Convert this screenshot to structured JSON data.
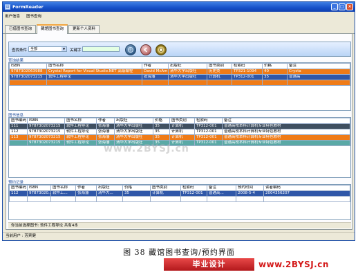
{
  "window": {
    "title": "FormReader",
    "app_icon": "app-form-icon",
    "buttons": [
      "_",
      "□",
      "×"
    ]
  },
  "menu": {
    "items": [
      "用户信息",
      "图书查询"
    ]
  },
  "tabs": [
    {
      "label": "已借图书查询"
    },
    {
      "label": "藏馆图书查询",
      "active": true
    },
    {
      "label": "更新个人资料"
    }
  ],
  "search": {
    "section_label": "查找条件",
    "condition_value": "全部",
    "keyword_label": "关键字",
    "keyword_value": "",
    "buttons": [
      {
        "name": "search-button",
        "icon": "globe-search-icon"
      },
      {
        "name": "back-button",
        "icon": "back-arrow-icon"
      },
      {
        "name": "reset-button",
        "icon": "ring-icon"
      }
    ]
  },
  "results": {
    "title": "查询结果",
    "headers": [
      "ISBN",
      "图书名称",
      "作者",
      "出版社",
      "图书类别",
      "检索码",
      "价格",
      "备注"
    ],
    "rows": [
      {
        "style": "orange",
        "cells": [
          "9787302063988",
          "Crystal Report for Visual Studio.NET 高级编程",
          "David McAmis",
          "清华大学出版社",
          "历史类",
          "TP321-1094",
          "40",
          "Crysta"
        ]
      },
      {
        "style": "sel",
        "cells": [
          "9787302073215",
          "软件工程导论",
          "张海藩",
          "清华大学出版社",
          "计算机",
          "TP312-001",
          "35",
          "普通高"
        ]
      },
      {
        "style": "orange",
        "cells": [
          "",
          "",
          "",
          "",
          "",
          "",
          "",
          ""
        ]
      }
    ]
  },
  "bookinfo": {
    "title": "图书信息",
    "headers": [
      "图书编码",
      "ISBN",
      "图书名称",
      "作者",
      "出版社",
      "价格",
      "图书类别",
      "检索码",
      "备注"
    ],
    "rows": [
      {
        "style": "dark",
        "cells": [
          "111",
          "9787302073215",
          "软件工程导论",
          "张海藩",
          "清华大学出版社",
          "35",
          "计算机",
          "TP312-001",
          "普通高校本科计算机专业特色教材"
        ]
      },
      {
        "style": "white",
        "cells": [
          "112",
          "9787302073215",
          "软件工程导论",
          "张海藩",
          "清华大学出版社",
          "35",
          "计算机",
          "TP312-001",
          "普通高校本科计算机专业特色教材"
        ]
      },
      {
        "style": "orange",
        "cells": [
          "113",
          "9787302073215",
          "软件工程导论",
          "张海藩",
          "清华大学出版社",
          "35",
          "计算机",
          "TP312-001",
          "普通高校本科计算机专业特色教材"
        ]
      },
      {
        "style": "teal",
        "cells": [
          "",
          "9787302073215",
          "软件工程导论",
          "张海藩",
          "清华大学出版社",
          "35",
          "计算机",
          "TP312-001",
          "普通高校本科计算机专业特色教材"
        ]
      }
    ]
  },
  "reservation": {
    "title": "预约记录",
    "headers": [
      "图书编码",
      "ISBN",
      "图书名称",
      "作者",
      "出版社",
      "价格",
      "图书类别",
      "检索码",
      "备注",
      "预约时间",
      "读者编码"
    ],
    "rows": [
      {
        "style": "sel",
        "cells": [
          "112",
          "97873020...",
          "软件工...",
          "张海藩",
          "清华大...",
          "35",
          "计算机",
          "TP312-001",
          "普通高...",
          "2008-5-4",
          "2004356207"
        ]
      },
      {
        "style": "white",
        "cells": [
          "",
          "",
          "",
          "",
          "",
          "",
          "",
          "",
          "",
          "",
          ""
        ]
      }
    ]
  },
  "status_message": "你当前选择图书: 软件工程导论 共有4本",
  "window_status": "当前用户 : 芳宾健",
  "figure_caption": "图 38   藏馆图书查询/预约界面",
  "watermark": {
    "banner": "毕业设计",
    "url": "www.2BYSJ.cn",
    "mid": "www.2BYSJ.cn"
  },
  "colors": {
    "title_blue": "#1550c8",
    "orange_row": "#ef7b17",
    "selected_row": "#2f57a8",
    "green_row": "#b7e8a1",
    "teal_row": "#5aa9a6",
    "watermark_red": "#d41a1a"
  }
}
